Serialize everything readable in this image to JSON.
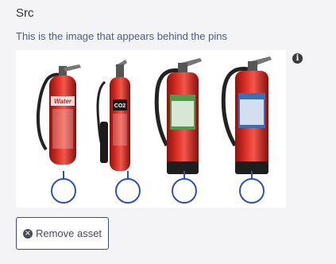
{
  "field": {
    "title": "Src",
    "description": "This is the image that appears behind the pins"
  },
  "image": {
    "extinguishers": [
      {
        "label": "Water",
        "label_color": "#ffffff",
        "band_color": "#d23a2a"
      },
      {
        "label": "CO2",
        "label_color": "#ffffff",
        "band_color": "#222222"
      },
      {
        "label": "",
        "label_color": "#ffffff",
        "band_color": "#4e9a4a"
      },
      {
        "label": "",
        "label_color": "#ffffff",
        "band_color": "#3b6db8"
      }
    ],
    "pin_color": "#2f4fbf",
    "pin_count": 4
  },
  "info_icon": "info-icon",
  "remove_button": {
    "label": "Remove asset",
    "icon": "times-circle-icon"
  },
  "colors": {
    "accent": "#3a4a7a",
    "description_text": "#4a5a8f",
    "extinguisher_red": "#c8251d"
  }
}
